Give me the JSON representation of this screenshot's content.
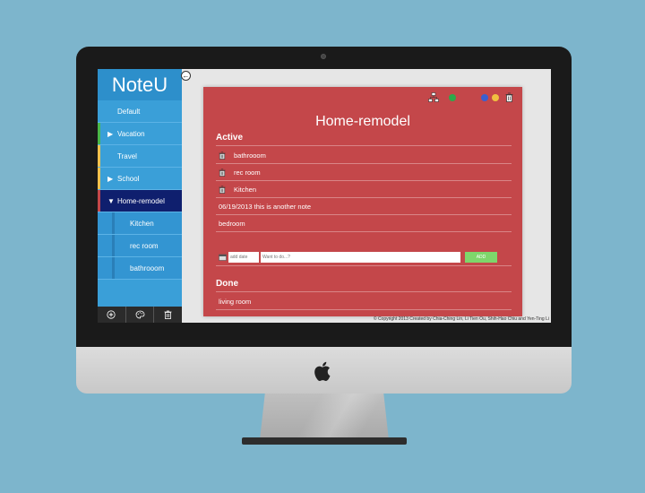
{
  "sidebar": {
    "brand": "NoteU",
    "items": [
      {
        "label": "Default",
        "arrow": "",
        "stripe": "",
        "type": "top"
      },
      {
        "label": "Vacation",
        "arrow": "▶",
        "stripe": "#4bb84a",
        "type": "top"
      },
      {
        "label": "Travel",
        "arrow": "",
        "stripe": "#f2c24f",
        "type": "top"
      },
      {
        "label": "School",
        "arrow": "▶",
        "stripe": "#f2c24f",
        "type": "top"
      },
      {
        "label": "Home-remodel",
        "arrow": "▼",
        "stripe": "#c4474a",
        "type": "active"
      },
      {
        "label": "Kitchen",
        "arrow": "",
        "stripe": "",
        "type": "sub"
      },
      {
        "label": "rec room",
        "arrow": "",
        "stripe": "",
        "type": "sub"
      },
      {
        "label": "bathrooom",
        "arrow": "",
        "stripe": "",
        "type": "sub"
      }
    ],
    "footer": {
      "add_icon": "plus-circle-icon",
      "palette_icon": "palette-icon",
      "trash_icon": "trash-icon"
    }
  },
  "collapse": {
    "icon": "arrow-left-circle-icon",
    "glyph": "←"
  },
  "panel": {
    "title": "Home-remodel",
    "toolbar": {
      "icons": [
        "sitemap-icon",
        "green-dot",
        "blue-dot",
        "yellow-dot",
        "trash-icon"
      ],
      "colors": {
        "green": "#2da84a",
        "blue": "#3a5fd0",
        "yellow": "#f0c040"
      }
    },
    "active_title": "Active",
    "active_items": [
      {
        "text": "bathrooom",
        "has_icon": true
      },
      {
        "text": "rec room",
        "has_icon": true
      },
      {
        "text": "Kitchen",
        "has_icon": true
      },
      {
        "text": "06/19/2013  this is another note",
        "has_icon": false
      },
      {
        "text": "bedroom",
        "has_icon": false
      }
    ],
    "add_form": {
      "date_placeholder": "add date",
      "todo_placeholder": "Want to do...?",
      "add_label": "ADD"
    },
    "done_title": "Done",
    "done_items": [
      {
        "text": "living room"
      }
    ]
  },
  "copyright": "© Copyright 2013 Created by Chia-Ching Lin, Li Tien Ou, Shih-Hao Chiu and Yen-Ting Li",
  "colors": {
    "background": "#7db5cc",
    "sidebar": "#3a9fd8",
    "panel": "#c4474a",
    "active_nav": "#0f1f6e",
    "add_button": "#7ed66b"
  }
}
